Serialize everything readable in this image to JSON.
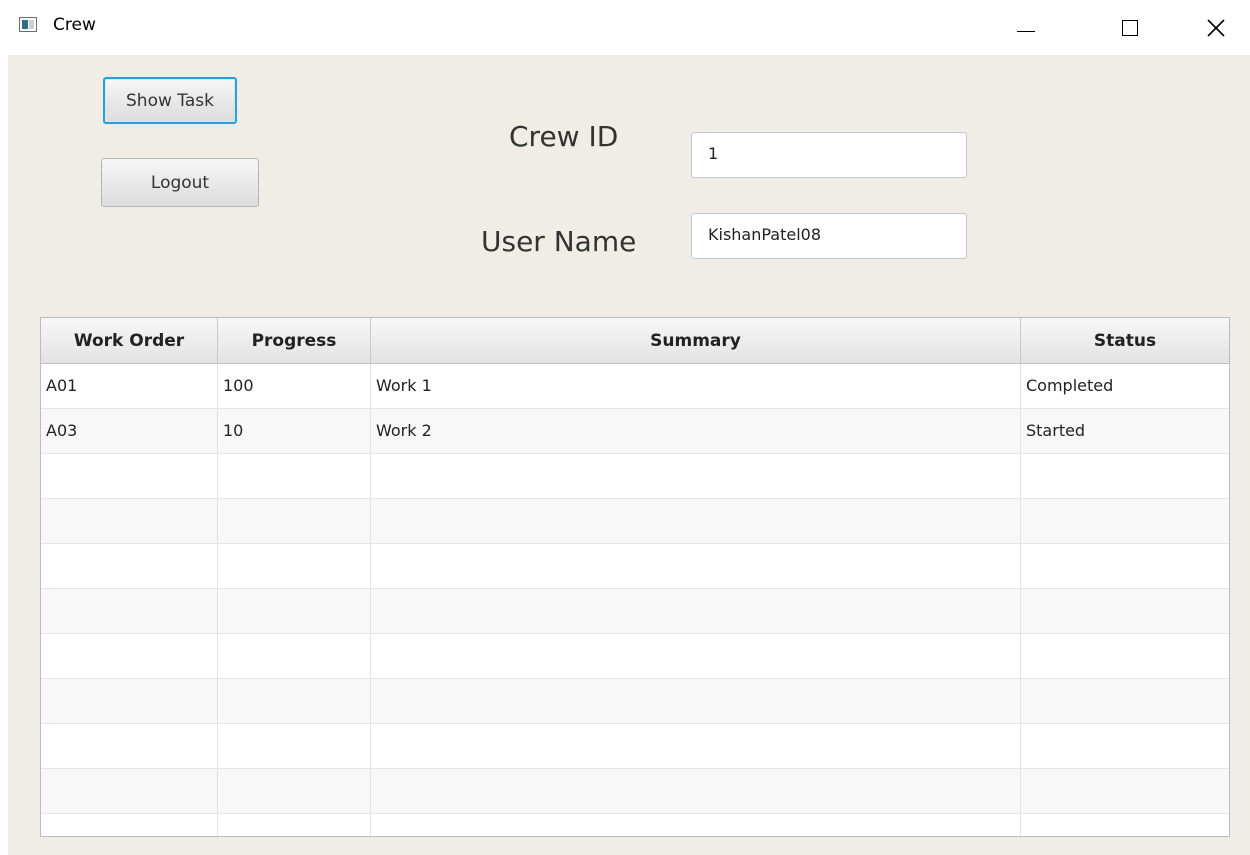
{
  "window": {
    "title": "Crew"
  },
  "toolbar": {
    "show_task_label": "Show Task",
    "logout_label": "Logout"
  },
  "form": {
    "crew_id_label": "Crew ID",
    "crew_id_value": "1",
    "user_name_label": "User Name",
    "user_name_value": "KishanPatel08"
  },
  "table": {
    "columns": [
      "Work Order",
      "Progress",
      "Summary",
      "Status"
    ],
    "rows": [
      {
        "work_order": "A01",
        "progress": "100",
        "summary": "Work 1",
        "status": "Completed"
      },
      {
        "work_order": "A03",
        "progress": "10",
        "summary": "Work 2",
        "status": "Started"
      }
    ]
  }
}
